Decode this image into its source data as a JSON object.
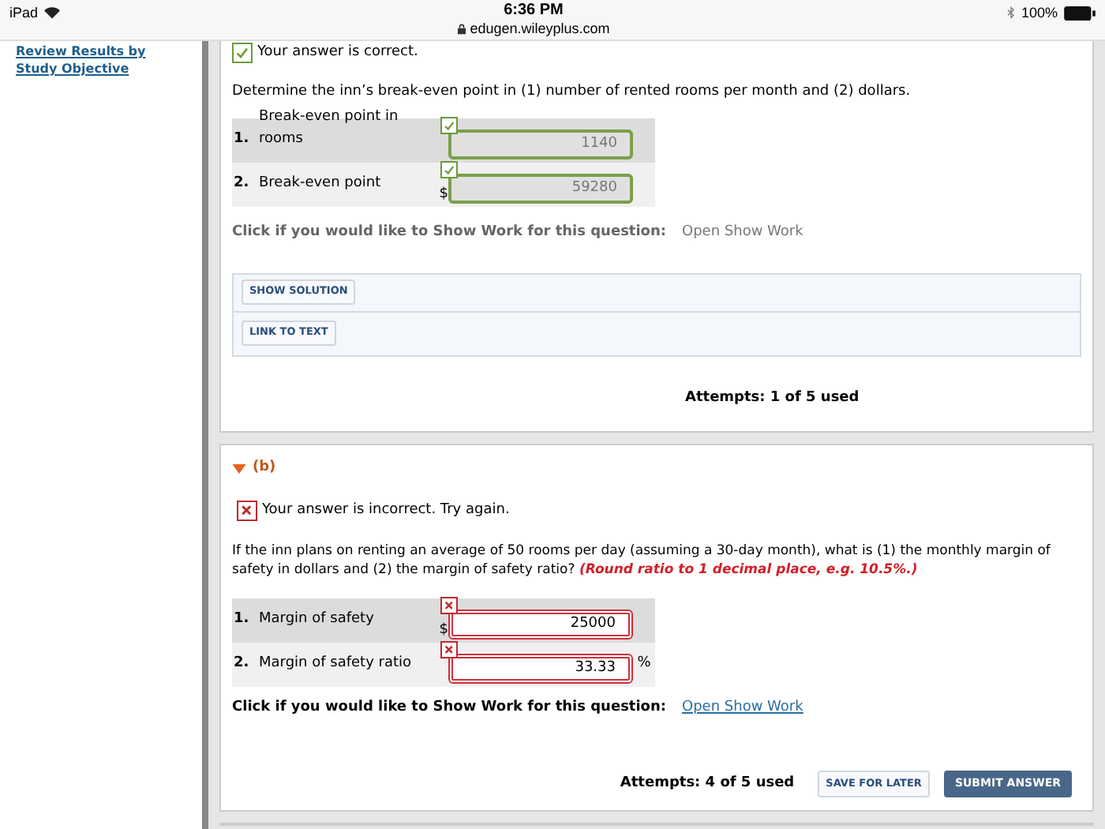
{
  "status_bar": {
    "device": "iPad",
    "time": "6:36 PM",
    "url": "edugen.wileyplus.com",
    "battery": "100%"
  },
  "sidebar": {
    "link": "Review Results by Study Objective"
  },
  "part_a": {
    "result": {
      "correct": true,
      "text": "Your answer is correct."
    },
    "question": "Determine the inn’s break-even point in (1) number of rented rooms per month and (2) dollars.",
    "answers": [
      {
        "number": "1.",
        "label": "Break-even point in rooms",
        "value": "1140",
        "correct": true
      },
      {
        "number": "2.",
        "label": "Break-even point",
        "prefix": "$",
        "value": "59280",
        "correct": true
      }
    ],
    "show_work": {
      "prompt": "Click if you would like to Show Work for this question:",
      "link": "Open Show Work",
      "disabled": true
    },
    "buttons": [
      "SHOW SOLUTION",
      "LINK TO TEXT"
    ],
    "attempts": "Attempts: 1 of 5 used"
  },
  "part_b": {
    "title": "(b)",
    "expanded": true,
    "result": {
      "correct": false,
      "text": "Your answer is incorrect.  Try again."
    },
    "question": "If the inn plans on renting an average of 50 rooms per day (assuming a 30-day month), what is (1) the monthly margin of safety in dollars and (2) the margin of safety ratio? ",
    "hint": "(Round ratio to 1 decimal place, e.g. 10.5%.)",
    "answers": [
      {
        "number": "1.",
        "label": "Margin of safety",
        "prefix": "$",
        "value": "25000",
        "correct": false
      },
      {
        "number": "2.",
        "label": "Margin of safety ratio",
        "suffix": "%",
        "value": "33.33",
        "correct": false
      }
    ],
    "show_work": {
      "prompt": "Click if you would like to Show Work for this question:",
      "link": "Open Show Work",
      "disabled": false
    },
    "attempts": "Attempts: 4 of 5 used",
    "save_button": "SAVE FOR LATER",
    "submit_button": "SUBMIT ANSWER"
  }
}
